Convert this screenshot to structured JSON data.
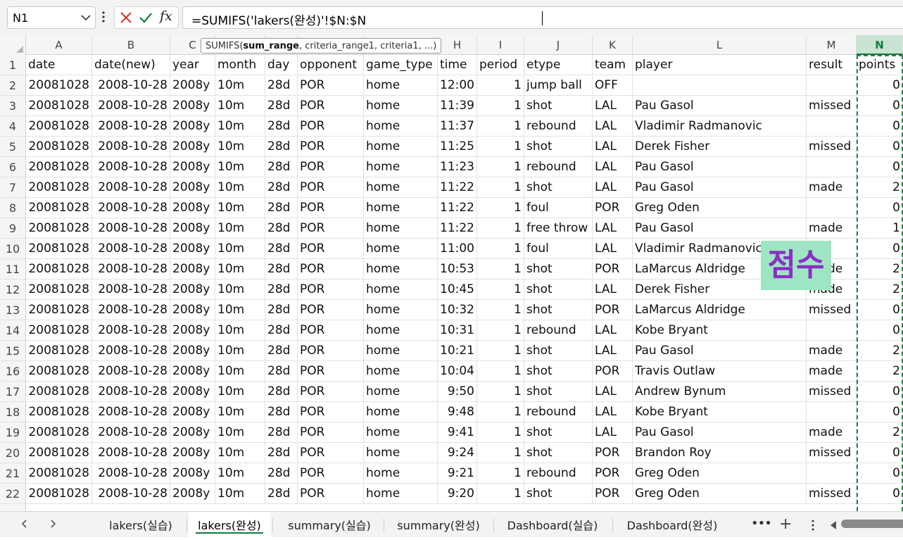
{
  "formula_bar": {
    "name_box": "N1",
    "formula": "=SUMIFS('lakers(완성)'!$N:$N",
    "fx_label": "fx"
  },
  "tooltip": {
    "func": "SUMIFS(",
    "bold_arg": "sum_range",
    "rest": ", criteria_range1, criteria1, ...)"
  },
  "columns": [
    "A",
    "B",
    "C",
    "D",
    "E",
    "F",
    "G",
    "H",
    "I",
    "J",
    "K",
    "L",
    "M",
    "N"
  ],
  "active_column": "N",
  "row_numbers": [
    "1",
    "2",
    "3",
    "4",
    "5",
    "6",
    "7",
    "8",
    "9",
    "10",
    "11",
    "12",
    "13",
    "14",
    "15",
    "16",
    "17",
    "18",
    "19",
    "20",
    "21",
    "22"
  ],
  "header_row": [
    "date",
    "date(new)",
    "year",
    "month",
    "day",
    "opponent",
    "game_type",
    "time",
    "period",
    "etype",
    "team",
    "player",
    "result",
    "points"
  ],
  "rows": [
    [
      "20081028",
      "2008-10-28",
      "2008y",
      "10m",
      "28d",
      "POR",
      "home",
      "12:00",
      "1",
      "jump ball",
      "OFF",
      "",
      "",
      "0"
    ],
    [
      "20081028",
      "2008-10-28",
      "2008y",
      "10m",
      "28d",
      "POR",
      "home",
      "11:39",
      "1",
      "shot",
      "LAL",
      "Pau Gasol",
      "missed",
      "0"
    ],
    [
      "20081028",
      "2008-10-28",
      "2008y",
      "10m",
      "28d",
      "POR",
      "home",
      "11:37",
      "1",
      "rebound",
      "LAL",
      "Vladimir Radmanovic",
      "",
      "0"
    ],
    [
      "20081028",
      "2008-10-28",
      "2008y",
      "10m",
      "28d",
      "POR",
      "home",
      "11:25",
      "1",
      "shot",
      "LAL",
      "Derek Fisher",
      "missed",
      "0"
    ],
    [
      "20081028",
      "2008-10-28",
      "2008y",
      "10m",
      "28d",
      "POR",
      "home",
      "11:23",
      "1",
      "rebound",
      "LAL",
      "Pau Gasol",
      "",
      "0"
    ],
    [
      "20081028",
      "2008-10-28",
      "2008y",
      "10m",
      "28d",
      "POR",
      "home",
      "11:22",
      "1",
      "shot",
      "LAL",
      "Pau Gasol",
      "made",
      "2"
    ],
    [
      "20081028",
      "2008-10-28",
      "2008y",
      "10m",
      "28d",
      "POR",
      "home",
      "11:22",
      "1",
      "foul",
      "POR",
      "Greg Oden",
      "",
      "0"
    ],
    [
      "20081028",
      "2008-10-28",
      "2008y",
      "10m",
      "28d",
      "POR",
      "home",
      "11:22",
      "1",
      "free throw",
      "LAL",
      "Pau Gasol",
      "made",
      "1"
    ],
    [
      "20081028",
      "2008-10-28",
      "2008y",
      "10m",
      "28d",
      "POR",
      "home",
      "11:00",
      "1",
      "foul",
      "LAL",
      "Vladimir Radmanovic",
      "",
      "0"
    ],
    [
      "20081028",
      "2008-10-28",
      "2008y",
      "10m",
      "28d",
      "POR",
      "home",
      "10:53",
      "1",
      "shot",
      "POR",
      "LaMarcus Aldridge",
      "made",
      "2"
    ],
    [
      "20081028",
      "2008-10-28",
      "2008y",
      "10m",
      "28d",
      "POR",
      "home",
      "10:45",
      "1",
      "shot",
      "LAL",
      "Derek Fisher",
      "made",
      "2"
    ],
    [
      "20081028",
      "2008-10-28",
      "2008y",
      "10m",
      "28d",
      "POR",
      "home",
      "10:32",
      "1",
      "shot",
      "POR",
      "LaMarcus Aldridge",
      "missed",
      "0"
    ],
    [
      "20081028",
      "2008-10-28",
      "2008y",
      "10m",
      "28d",
      "POR",
      "home",
      "10:31",
      "1",
      "rebound",
      "LAL",
      "Kobe Bryant",
      "",
      "0"
    ],
    [
      "20081028",
      "2008-10-28",
      "2008y",
      "10m",
      "28d",
      "POR",
      "home",
      "10:21",
      "1",
      "shot",
      "LAL",
      "Pau Gasol",
      "made",
      "2"
    ],
    [
      "20081028",
      "2008-10-28",
      "2008y",
      "10m",
      "28d",
      "POR",
      "home",
      "10:04",
      "1",
      "shot",
      "POR",
      "Travis Outlaw",
      "made",
      "2"
    ],
    [
      "20081028",
      "2008-10-28",
      "2008y",
      "10m",
      "28d",
      "POR",
      "home",
      "9:50",
      "1",
      "shot",
      "LAL",
      "Andrew Bynum",
      "missed",
      "0"
    ],
    [
      "20081028",
      "2008-10-28",
      "2008y",
      "10m",
      "28d",
      "POR",
      "home",
      "9:48",
      "1",
      "rebound",
      "LAL",
      "Kobe Bryant",
      "",
      "0"
    ],
    [
      "20081028",
      "2008-10-28",
      "2008y",
      "10m",
      "28d",
      "POR",
      "home",
      "9:41",
      "1",
      "shot",
      "LAL",
      "Pau Gasol",
      "made",
      "2"
    ],
    [
      "20081028",
      "2008-10-28",
      "2008y",
      "10m",
      "28d",
      "POR",
      "home",
      "9:24",
      "1",
      "shot",
      "POR",
      "Brandon Roy",
      "missed",
      "0"
    ],
    [
      "20081028",
      "2008-10-28",
      "2008y",
      "10m",
      "28d",
      "POR",
      "home",
      "9:21",
      "1",
      "rebound",
      "POR",
      "Greg Oden",
      "",
      "0"
    ],
    [
      "20081028",
      "2008-10-28",
      "2008y",
      "10m",
      "28d",
      "POR",
      "home",
      "9:20",
      "1",
      "shot",
      "POR",
      "Greg Oden",
      "missed",
      "0"
    ]
  ],
  "overlay_label": "점수",
  "sheet_tabs": [
    {
      "label": "lakers(실습)",
      "active": false
    },
    {
      "label": "lakers(완성)",
      "active": true
    },
    {
      "label": "summary(실습)",
      "active": false
    },
    {
      "label": "summary(완성)",
      "active": false
    },
    {
      "label": "Dashboard(실습)",
      "active": false
    },
    {
      "label": "Dashboard(완성)",
      "active": false
    }
  ],
  "tab_more": "•••",
  "tab_add": "+",
  "colors": {
    "accent": "#107c41",
    "selection_header": "#c8e4d2",
    "overlay_bg": "#9ee5c3",
    "overlay_text": "#8a2fc4"
  },
  "icons": [
    "chevron-down-icon",
    "more-vert-icon",
    "cancel-icon",
    "enter-icon",
    "fx-icon",
    "prev-sheet-icon",
    "next-sheet-icon",
    "scroll-left-icon"
  ]
}
